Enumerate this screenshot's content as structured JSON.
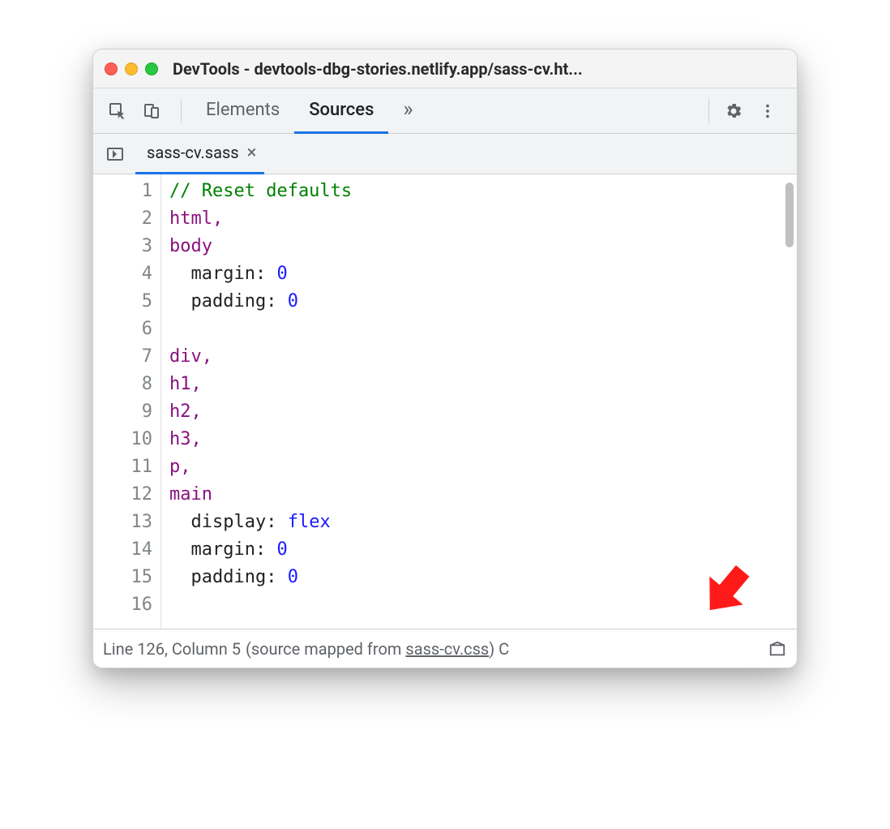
{
  "window": {
    "title": "DevTools - devtools-dbg-stories.netlify.app/sass-cv.ht..."
  },
  "toolbar": {
    "tabs": {
      "elements": "Elements",
      "sources": "Sources"
    }
  },
  "file_tab": {
    "name": "sass-cv.sass"
  },
  "code_lines": [
    {
      "n": 1,
      "tokens": [
        {
          "t": "// Reset defaults",
          "c": "comment"
        }
      ]
    },
    {
      "n": 2,
      "tokens": [
        {
          "t": "html",
          "c": "sel"
        },
        {
          "t": ",",
          "c": "sel"
        }
      ]
    },
    {
      "n": 3,
      "tokens": [
        {
          "t": "body",
          "c": "sel"
        }
      ]
    },
    {
      "n": 4,
      "tokens": [
        {
          "t": "  ",
          "c": ""
        },
        {
          "t": "margin",
          "c": "prop"
        },
        {
          "t": ": ",
          "c": ""
        },
        {
          "t": "0",
          "c": "val-num"
        }
      ]
    },
    {
      "n": 5,
      "tokens": [
        {
          "t": "  ",
          "c": ""
        },
        {
          "t": "padding",
          "c": "prop"
        },
        {
          "t": ": ",
          "c": ""
        },
        {
          "t": "0",
          "c": "val-num"
        }
      ]
    },
    {
      "n": 6,
      "tokens": [
        {
          "t": "",
          "c": ""
        }
      ]
    },
    {
      "n": 7,
      "tokens": [
        {
          "t": "div",
          "c": "sel"
        },
        {
          "t": ",",
          "c": "sel"
        }
      ]
    },
    {
      "n": 8,
      "tokens": [
        {
          "t": "h1",
          "c": "sel"
        },
        {
          "t": ",",
          "c": "sel"
        }
      ]
    },
    {
      "n": 9,
      "tokens": [
        {
          "t": "h2",
          "c": "sel"
        },
        {
          "t": ",",
          "c": "sel"
        }
      ]
    },
    {
      "n": 10,
      "tokens": [
        {
          "t": "h3",
          "c": "sel"
        },
        {
          "t": ",",
          "c": "sel"
        }
      ]
    },
    {
      "n": 11,
      "tokens": [
        {
          "t": "p",
          "c": "sel"
        },
        {
          "t": ",",
          "c": "sel"
        }
      ]
    },
    {
      "n": 12,
      "tokens": [
        {
          "t": "main",
          "c": "sel"
        }
      ]
    },
    {
      "n": 13,
      "tokens": [
        {
          "t": "  ",
          "c": ""
        },
        {
          "t": "display",
          "c": "prop"
        },
        {
          "t": ": ",
          "c": ""
        },
        {
          "t": "flex",
          "c": "val-kw"
        }
      ]
    },
    {
      "n": 14,
      "tokens": [
        {
          "t": "  ",
          "c": ""
        },
        {
          "t": "margin",
          "c": "prop"
        },
        {
          "t": ": ",
          "c": ""
        },
        {
          "t": "0",
          "c": "val-num"
        }
      ]
    },
    {
      "n": 15,
      "tokens": [
        {
          "t": "  ",
          "c": ""
        },
        {
          "t": "padding",
          "c": "prop"
        },
        {
          "t": ": ",
          "c": ""
        },
        {
          "t": "0",
          "c": "val-num"
        }
      ]
    },
    {
      "n": 16,
      "tokens": [
        {
          "t": "",
          "c": ""
        }
      ]
    }
  ],
  "status": {
    "cursor_label": "Line 126, Column 5",
    "mapped_prefix": " (source mapped from ",
    "mapped_file": "sass-cv.css",
    "mapped_suffix": ")  C",
    "coverage_char": ""
  }
}
